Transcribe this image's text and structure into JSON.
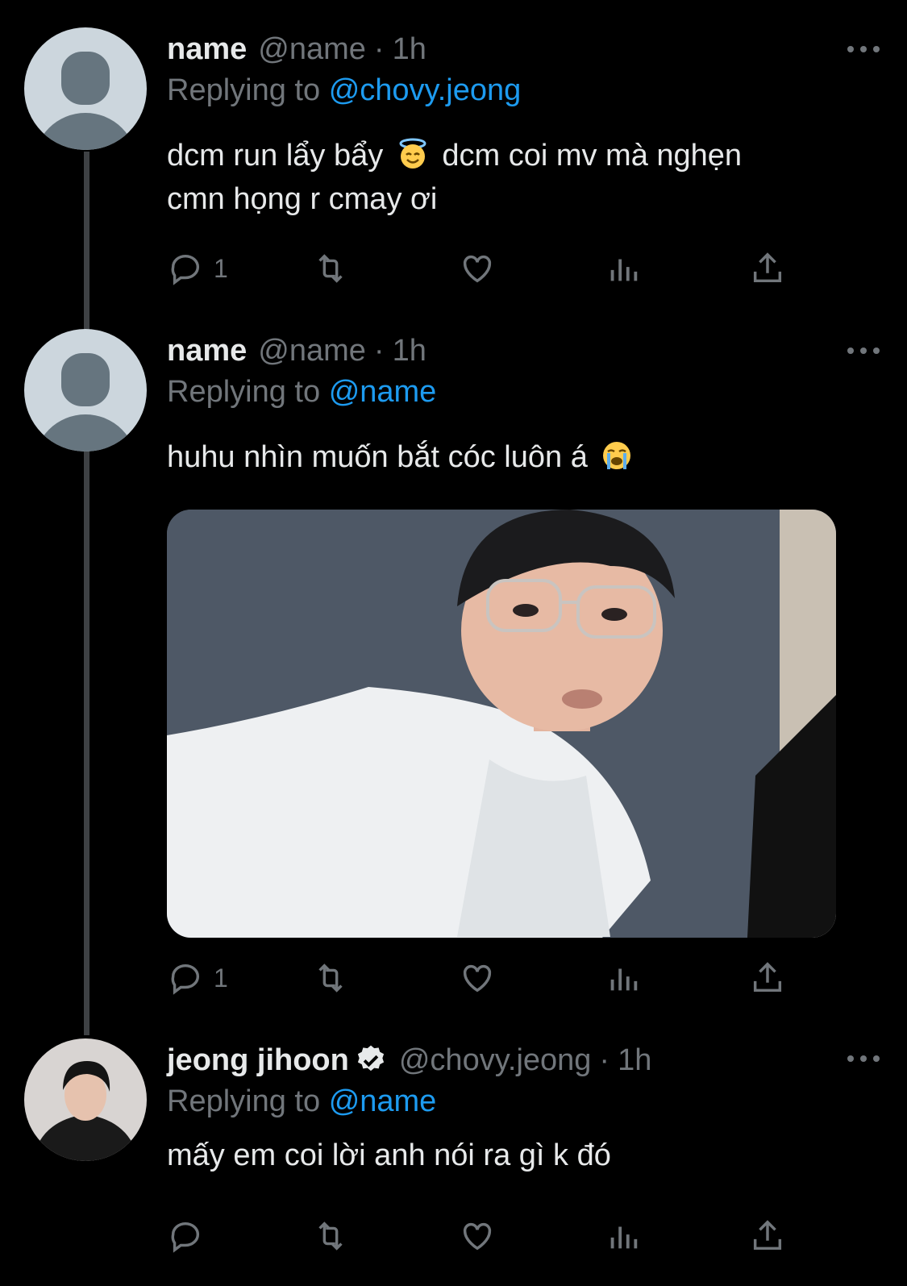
{
  "tweets": [
    {
      "display_name": "name",
      "handle": "@name",
      "separator": "·",
      "time": "1h",
      "replying_prefix": "Replying to",
      "replying_to": "@chovy.jeong",
      "text_part1": "dcm run lẩy bẩy",
      "emoji": "smiling-face-with-halo",
      "text_part2": "dcm coi mv mà nghẹn",
      "text_line2": "cmn họng r cmay ơi",
      "reply_count": "1"
    },
    {
      "display_name": "name",
      "handle": "@name",
      "separator": "·",
      "time": "1h",
      "replying_prefix": "Replying to",
      "replying_to": "@name",
      "text_part1": "huhu nhìn muốn bắt cóc luôn á",
      "emoji": "loudly-crying-face",
      "reply_count": "1",
      "media": "photo of young man with glasses in white jacket"
    },
    {
      "display_name": "jeong jihoon",
      "verified": true,
      "handle": "@chovy.jeong",
      "separator": "·",
      "time": "1h",
      "replying_prefix": "Replying to",
      "replying_to": "@name",
      "text_part1": "mấy em coi lời anh nói ra gì k đó",
      "reply_count": ""
    }
  ],
  "colors": {
    "background": "#000000",
    "text": "#e7e9ea",
    "muted": "#71767b",
    "link": "#1d9bf0",
    "thread_line": "#3e4144"
  },
  "icons": [
    "reply-icon",
    "retweet-icon",
    "like-icon",
    "analytics-icon",
    "share-icon",
    "more-icon"
  ]
}
